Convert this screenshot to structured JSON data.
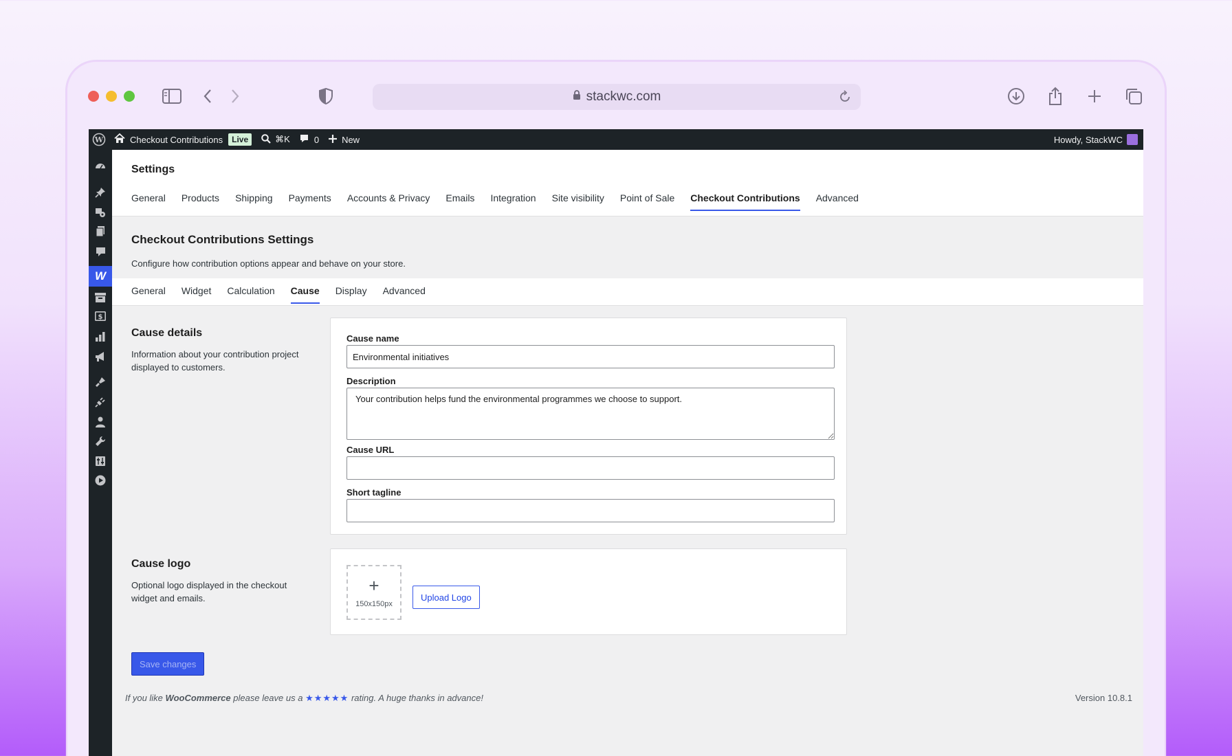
{
  "browser": {
    "url": "stackwc.com"
  },
  "adminbar": {
    "site_name": "Checkout Contributions",
    "live_badge": "Live",
    "search_shortcut": "⌘K",
    "comments_count": "0",
    "new_label": "New",
    "howdy": "Howdy, StackWC"
  },
  "header": {
    "title": "Settings",
    "tabs": [
      "General",
      "Products",
      "Shipping",
      "Payments",
      "Accounts & Privacy",
      "Emails",
      "Integration",
      "Site visibility",
      "Point of Sale",
      "Checkout Contributions",
      "Advanced"
    ],
    "active_tab": "Checkout Contributions"
  },
  "section": {
    "title": "Checkout Contributions Settings",
    "description": "Configure how contribution options appear and behave on your store."
  },
  "subtabs": {
    "items": [
      "General",
      "Widget",
      "Calculation",
      "Cause",
      "Display",
      "Advanced"
    ],
    "active": "Cause"
  },
  "cause_details": {
    "heading": "Cause details",
    "description": "Information about your contribution project displayed to customers.",
    "cause_name_label": "Cause name",
    "cause_name_value": "Environmental initiatives",
    "description_label": "Description",
    "description_value": "Your contribution helps fund the environmental programmes we choose to support.",
    "cause_url_label": "Cause URL",
    "cause_url_value": "",
    "tagline_label": "Short tagline",
    "tagline_value": ""
  },
  "cause_logo": {
    "heading": "Cause logo",
    "description": "Optional logo displayed in the checkout widget and emails.",
    "placeholder_plus": "+",
    "placeholder_size": "150x150px",
    "upload_label": "Upload Logo"
  },
  "save_label": "Save changes",
  "footer": {
    "prefix": "If you like ",
    "brand": "WooCommerce",
    "middle": " please leave us a ",
    "stars": "★★★★★",
    "suffix": " rating. A huge thanks in advance!",
    "version": "Version 10.8.1"
  },
  "colors": {
    "accent": "#3858e9",
    "adminbar": "#1d2327",
    "background": "#f0f0f1"
  }
}
